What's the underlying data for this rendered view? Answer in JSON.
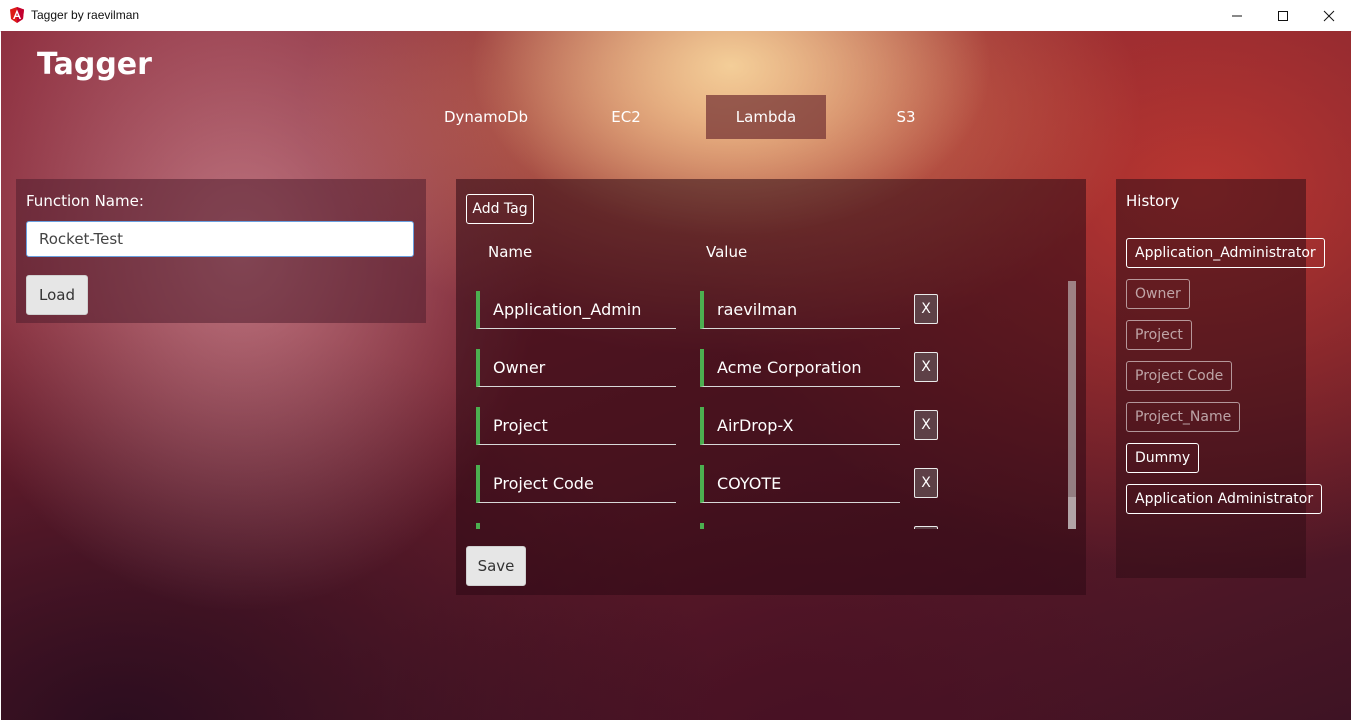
{
  "window": {
    "title": "Tagger by raevilman",
    "logo_icon": "angular-logo-icon",
    "controls": [
      "minimize-icon",
      "maximize-icon",
      "close-icon"
    ]
  },
  "app": {
    "title": "Tagger"
  },
  "nav": {
    "tabs": [
      {
        "label": "DynamoDb",
        "active": false
      },
      {
        "label": "EC2",
        "active": false
      },
      {
        "label": "Lambda",
        "active": true
      },
      {
        "label": "S3",
        "active": false
      }
    ]
  },
  "left_panel": {
    "label": "Function Name:",
    "input_value": "Rocket-Test",
    "load_label": "Load"
  },
  "tags_panel": {
    "add_tag_label": "Add Tag",
    "name_header": "Name",
    "value_header": "Value",
    "remove_label": "X",
    "rows": [
      {
        "name": "Application_Admin",
        "value": "raevilman"
      },
      {
        "name": "Owner",
        "value": "Acme Corporation"
      },
      {
        "name": "Project",
        "value": "AirDrop-X"
      },
      {
        "name": "Project Code",
        "value": "COYOTE"
      },
      {
        "name": "",
        "value": ""
      }
    ],
    "save_label": "Save",
    "accent_color": "#4caf50"
  },
  "history": {
    "title": "History",
    "items": [
      {
        "label": "Application_Administrator",
        "dim": false
      },
      {
        "label": "Owner",
        "dim": true
      },
      {
        "label": "Project",
        "dim": true
      },
      {
        "label": "Project Code",
        "dim": true
      },
      {
        "label": "Project_Name",
        "dim": true
      },
      {
        "label": "Dummy",
        "dim": false
      },
      {
        "label": "Application Administrator",
        "dim": false
      }
    ]
  }
}
